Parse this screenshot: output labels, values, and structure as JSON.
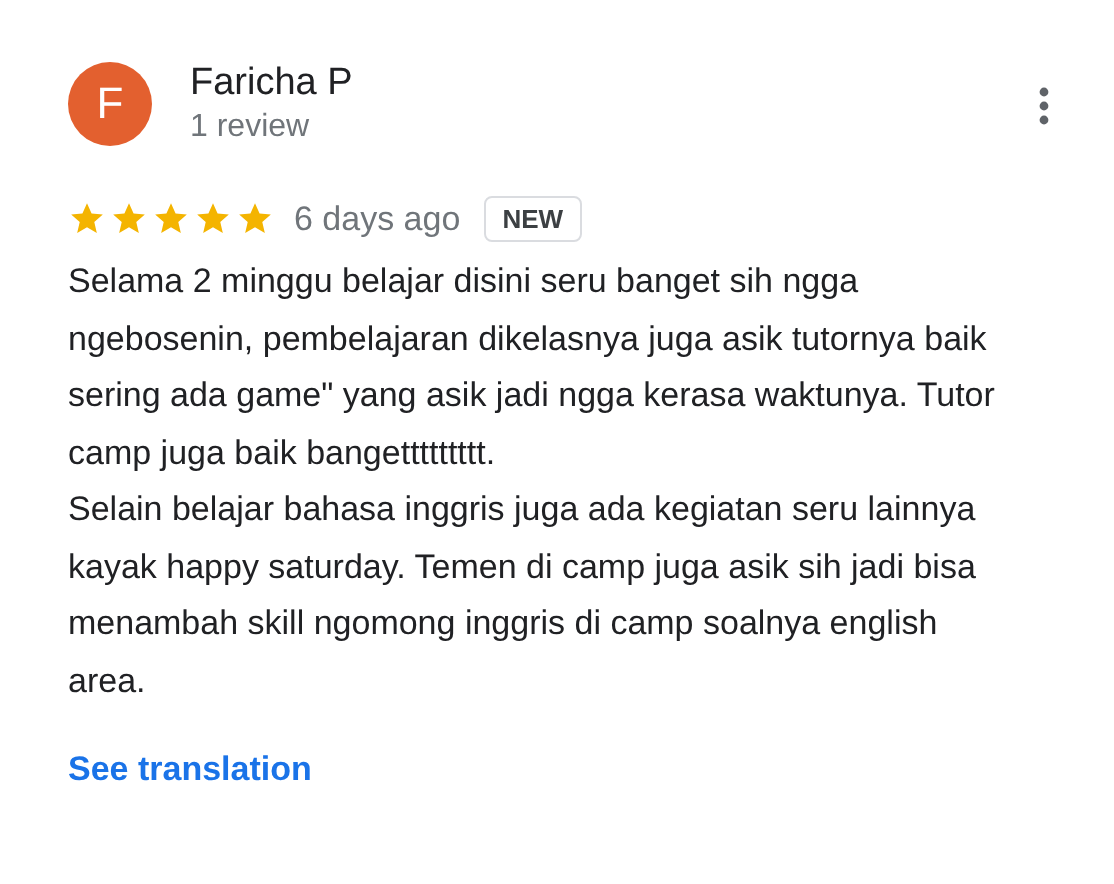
{
  "review": {
    "avatar": {
      "letter": "F",
      "color": "#e3602f"
    },
    "author": "Faricha P",
    "review_count": "1 review",
    "stars": 5,
    "date": "6 days ago",
    "badge": "NEW",
    "paragraphs": [
      "Selama 2 minggu belajar disini seru banget sih ngga ngebosenin, pembelajaran dikelasnya juga asik tutornya baik sering ada game\" yang asik jadi ngga kerasa waktunya. Tutor camp juga baik bangettttttttt.",
      "Selain belajar bahasa inggris juga ada kegiatan seru lainnya kayak happy saturday. Temen di camp juga asik sih jadi bisa menambah skill ngomong inggris di camp soalnya english area."
    ],
    "link": "See translation"
  }
}
